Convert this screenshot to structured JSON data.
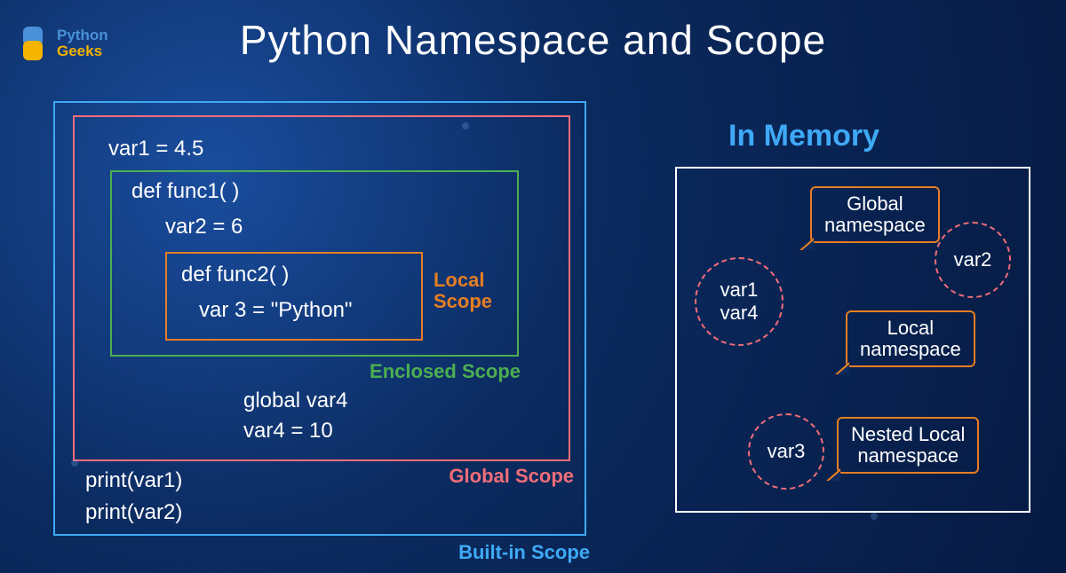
{
  "logo": {
    "line1": "Python",
    "line2": "Geeks"
  },
  "title": "Python Namespace and Scope",
  "scopes": {
    "builtin_label": "Built-in Scope",
    "global_label": "Global Scope",
    "enclosed_label": "Enclosed Scope",
    "local_label": "Local\nScope"
  },
  "code": {
    "var1": "var1 = 4.5",
    "def1": "def func1( )",
    "var2": "var2 = 6",
    "def2": "def func2( )",
    "var3": "var 3 = \"Python\"",
    "global_var4": "global var4",
    "var4_assign": "var4 = 10",
    "print1": "print(var1)",
    "print2": "print(var2)"
  },
  "memory": {
    "title": "In Memory",
    "circle1_line1": "var1",
    "circle1_line2": "var4",
    "circle2": "var2",
    "circle3": "var3",
    "callout1": "Global\nnamespace",
    "callout2": "Local\nnamespace",
    "callout3": "Nested Local\nnamespace"
  },
  "colors": {
    "builtin": "#3fa9f5",
    "global": "#f26d78",
    "enclosed": "#4caf50",
    "local": "#e67e22"
  }
}
